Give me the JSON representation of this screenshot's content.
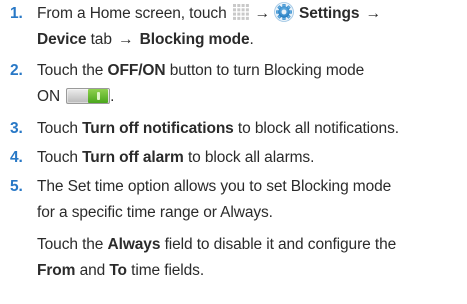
{
  "steps": [
    {
      "number": "1.",
      "line1": {
        "pre": "From a Home screen, touch",
        "arrow1": "→",
        "settings": "Settings",
        "arrow2": "→"
      },
      "line2": {
        "device": "Device",
        "tab": " tab ",
        "arrow": "→",
        "blocking": " Blocking mode",
        "end": "."
      }
    },
    {
      "number": "2.",
      "line1": {
        "pre": "Touch the ",
        "offon": "OFF/ON",
        "post": " button to turn Blocking mode"
      },
      "line2": {
        "on": "ON",
        "end": "."
      }
    },
    {
      "number": "3.",
      "line1": {
        "pre": "Touch ",
        "bold": "Turn off notifications",
        "post": " to block all notifications."
      }
    },
    {
      "number": "4.",
      "line1": {
        "pre": "Touch ",
        "bold": "Turn off alarm",
        "post": " to block all alarms."
      }
    },
    {
      "number": "5.",
      "line1": "The Set time option allows you to set Blocking mode",
      "line2": "for a specific time range or Always.",
      "line3": {
        "pre": "Touch the ",
        "bold": "Always",
        "post": " field to disable it and configure the"
      },
      "line4": {
        "from": "From",
        "and": " and ",
        "to": "To",
        "post": " time fields."
      }
    }
  ],
  "colors": {
    "step_number": "#2878c6",
    "text": "#2b2b2b",
    "gear_icon": "#2a86c9",
    "toggle_on": "#5cb82a"
  },
  "icons": [
    "apps-icon",
    "settings-gear-icon",
    "arrow-right",
    "toggle-switch-icon"
  ],
  "toggle_state": "on"
}
